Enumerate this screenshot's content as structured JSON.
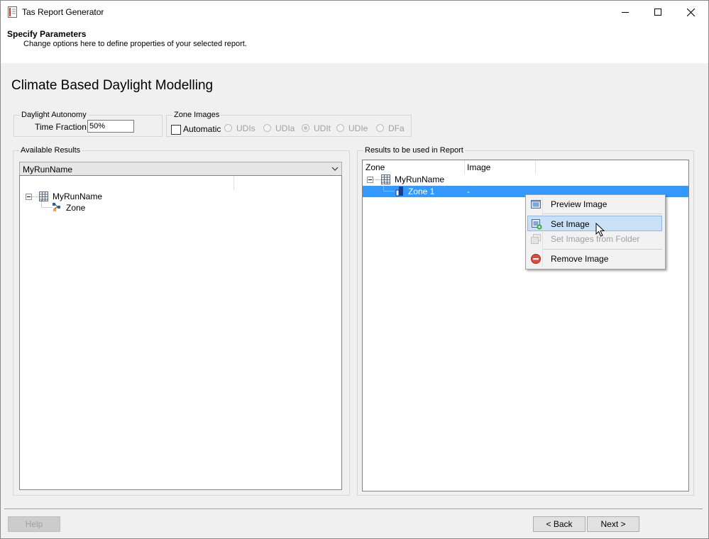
{
  "window": {
    "title": "Tas Report Generator"
  },
  "header": {
    "title": "Specify Parameters",
    "subtitle": "Change options here to define properties of your selected report."
  },
  "section_title": "Climate Based Daylight Modelling",
  "daylight_autonomy": {
    "legend": "Daylight Autonomy",
    "time_fraction_label": "Time Fraction",
    "time_fraction_value": "50%"
  },
  "zone_images": {
    "legend": "Zone Images",
    "automatic_label": "Automatic",
    "automatic_checked": false,
    "options": [
      {
        "label": "UDIs",
        "checked": false
      },
      {
        "label": "UDIa",
        "checked": false
      },
      {
        "label": "UDIt",
        "checked": true
      },
      {
        "label": "UDIe",
        "checked": false
      },
      {
        "label": "DFa",
        "checked": false
      }
    ]
  },
  "available_results": {
    "legend": "Available Results",
    "combo_value": "MyRunName",
    "tree": {
      "root": "MyRunName",
      "child": "Zone"
    }
  },
  "report_results": {
    "legend": "Results to be used in Report",
    "columns": [
      "Zone",
      "Image"
    ],
    "tree": {
      "root": "MyRunName",
      "rows": [
        {
          "zone": "Zone 1",
          "image": "-"
        }
      ]
    }
  },
  "context_menu": {
    "items": [
      {
        "label": "Preview Image",
        "icon": "preview-image-icon",
        "enabled": true
      },
      {
        "label": "Set Image",
        "icon": "set-image-icon",
        "enabled": true,
        "highlighted": true
      },
      {
        "label": "Set Images from Folder",
        "icon": "folder-images-icon",
        "enabled": false
      },
      {
        "label": "Remove Image",
        "icon": "remove-icon",
        "enabled": true
      }
    ]
  },
  "buttons": {
    "help": "Help",
    "back": "< Back",
    "next": "Next >"
  },
  "colors": {
    "selection": "#3399ff",
    "menu_highlight": "#c9e0f7",
    "window_bg": "#f0f0f0"
  }
}
